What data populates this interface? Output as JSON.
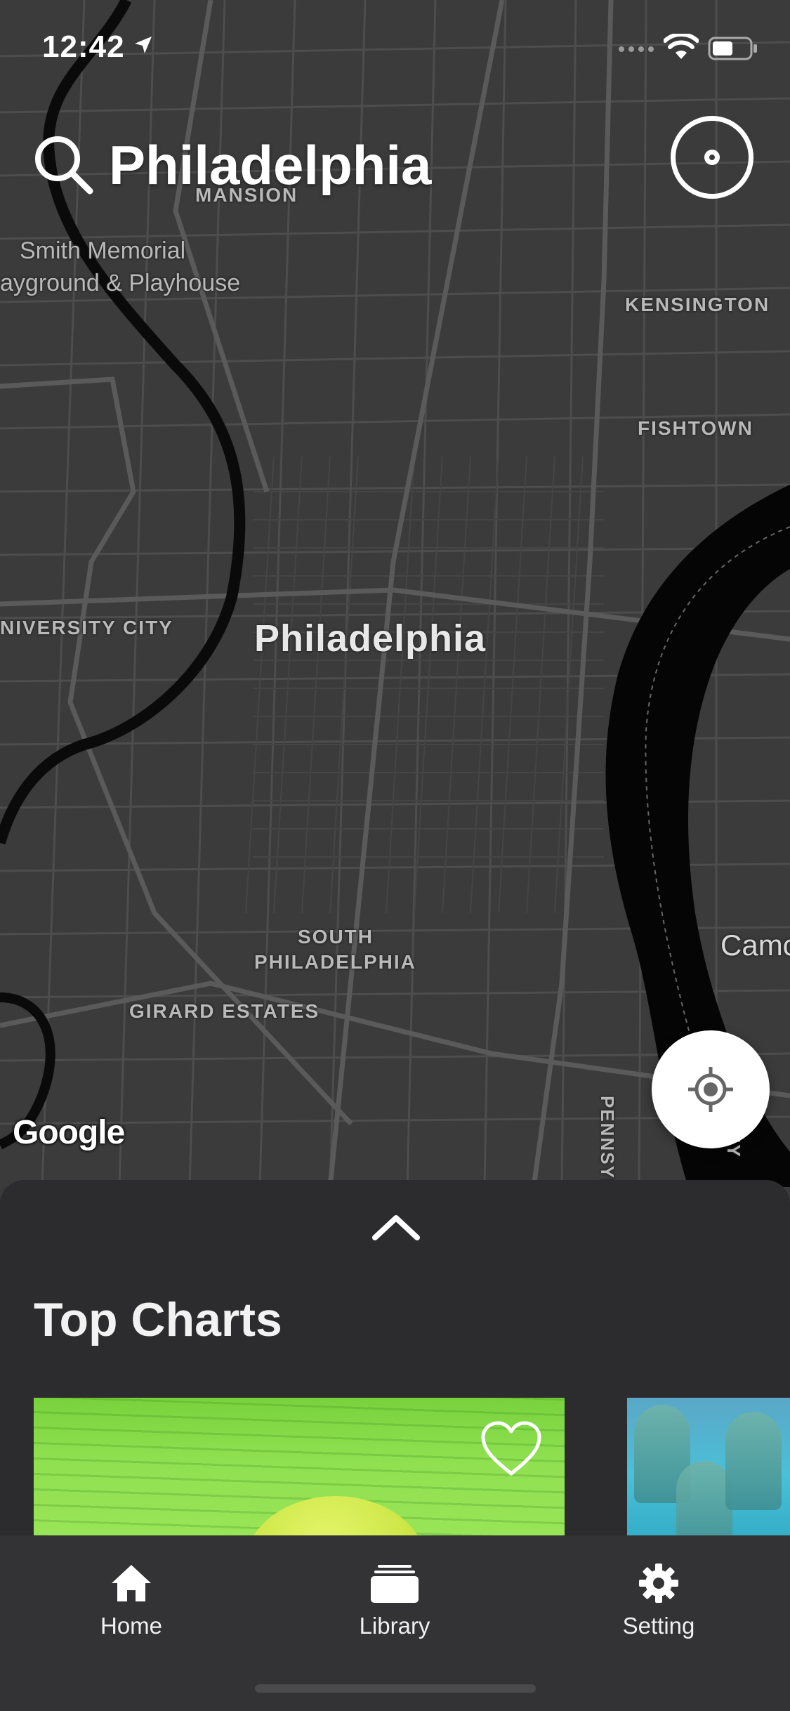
{
  "status_bar": {
    "time": "12:42",
    "location_icon": "location-arrow-icon",
    "signal_icon": "signal-dots-icon",
    "wifi_icon": "wifi-icon",
    "battery_icon": "battery-icon"
  },
  "search": {
    "icon": "search-icon",
    "title": "Philadelphia"
  },
  "map": {
    "labels": {
      "mansion": "MANSION",
      "smith_memorial_line1": "Smith Memorial",
      "smith_memorial_line2": "ayground & Playhouse",
      "kensington": "KENSINGTON",
      "fishtown": "FISHTOWN",
      "university_city": "NIVERSITY CITY",
      "city": "Philadelphia",
      "south_philadelphia_line1": "SOUTH",
      "south_philadelphia_line2": "PHILADELPHIA",
      "girard_estates": "GIRARD ESTATES",
      "camden": "Camc",
      "pennsylvania": "PENNSYLVANI",
      "river_right": "EY"
    },
    "attribution": "Google"
  },
  "buttons": {
    "record_icon": "record-target-icon",
    "locate_icon": "crosshair-icon"
  },
  "sheet": {
    "handle_icon": "chevron-up-icon",
    "title": "Top Charts",
    "cards": [
      {
        "name": "green-tennis-card",
        "liked_icon": "heart-outline-icon"
      },
      {
        "name": "blue-shoes-card"
      }
    ]
  },
  "tabbar": {
    "items": [
      {
        "label": "Home",
        "icon": "home-icon"
      },
      {
        "label": "Library",
        "icon": "library-icon"
      },
      {
        "label": "Setting",
        "icon": "gear-icon"
      }
    ]
  },
  "colors": {
    "map_bg": "#3b3b3b",
    "sheet_bg": "#2c2b2d",
    "tabbar_bg": "#333335",
    "text": "#ffffff"
  }
}
